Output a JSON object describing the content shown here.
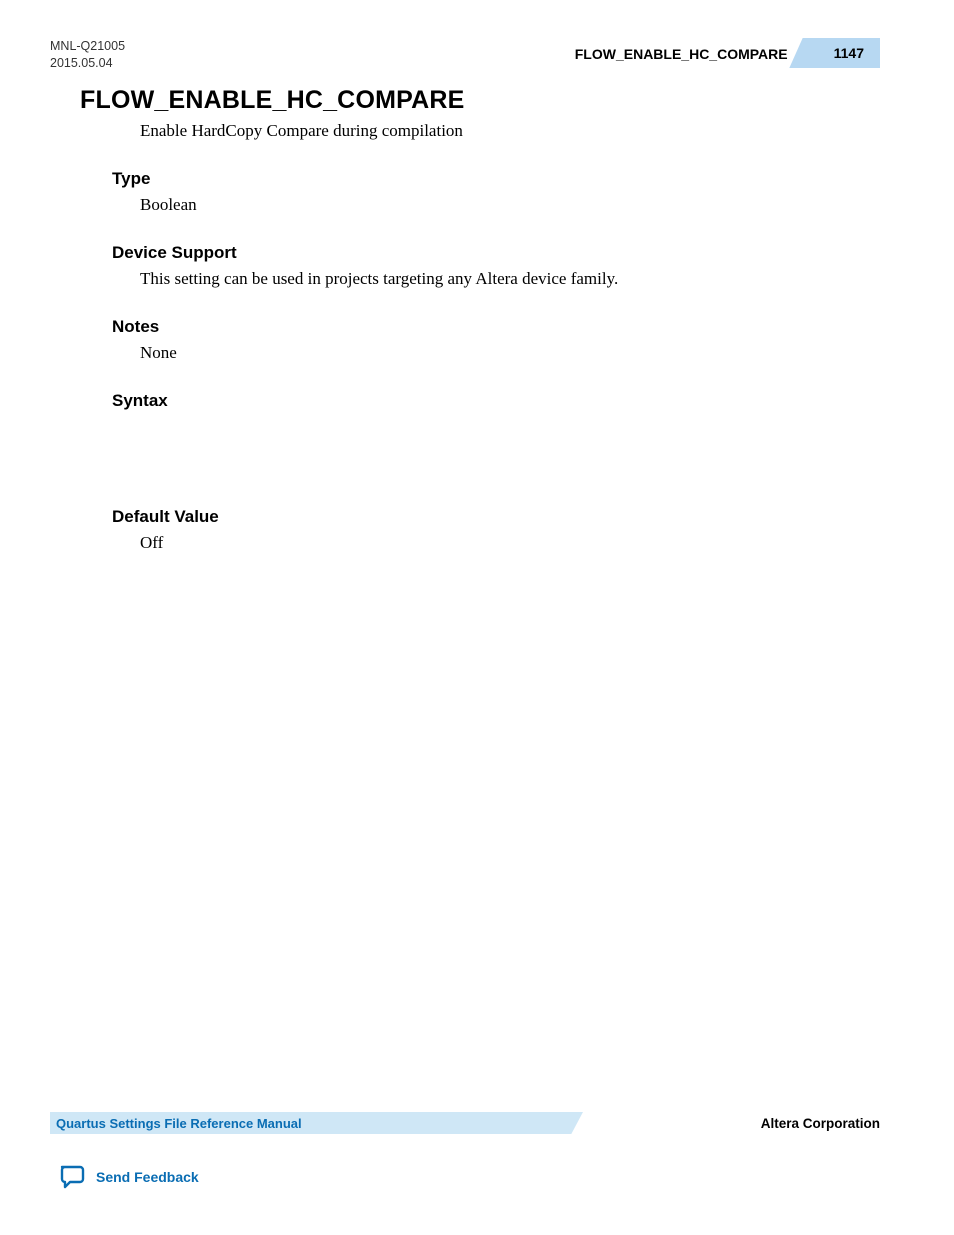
{
  "header": {
    "doc_id": "MNL-Q21005",
    "date": "2015.05.04",
    "running_title": "FLOW_ENABLE_HC_COMPARE",
    "page_number": "1147"
  },
  "main": {
    "title": "FLOW_ENABLE_HC_COMPARE",
    "intro": "Enable HardCopy Compare during compilation",
    "sections": {
      "type": {
        "heading": "Type",
        "body": "Boolean"
      },
      "device_support": {
        "heading": "Device Support",
        "body": "This setting can be used in projects targeting any Altera device family."
      },
      "notes": {
        "heading": "Notes",
        "body": "None"
      },
      "syntax": {
        "heading": "Syntax"
      },
      "default_value": {
        "heading": "Default Value",
        "body": "Off"
      }
    }
  },
  "footer": {
    "manual_title": "Quartus Settings File Reference Manual",
    "company": "Altera Corporation",
    "feedback_label": "Send Feedback"
  }
}
